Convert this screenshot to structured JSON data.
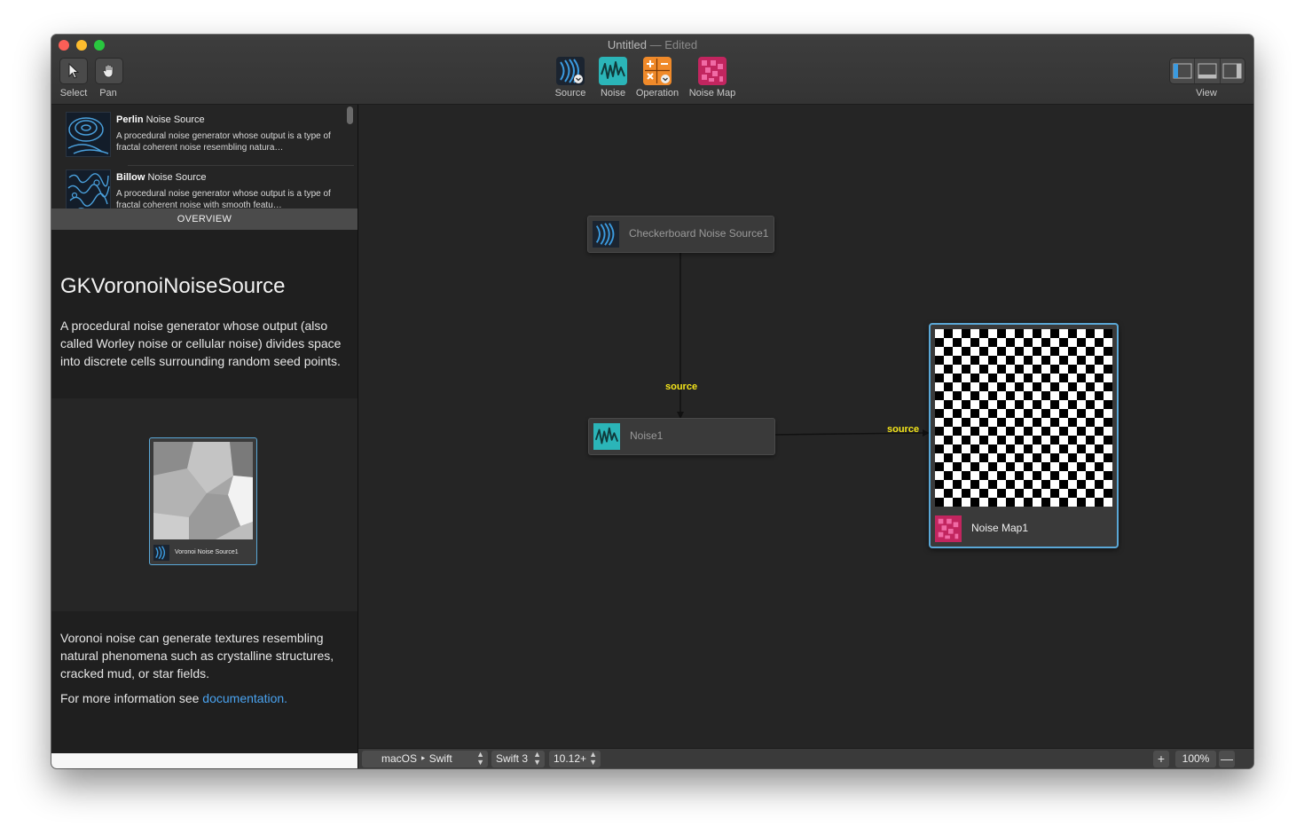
{
  "window": {
    "title": "Untitled",
    "title_suffix": "— Edited"
  },
  "toolbar": {
    "select_label": "Select",
    "pan_label": "Pan",
    "source_label": "Source",
    "noise_label": "Noise",
    "operation_label": "Operation",
    "noise_map_label": "Noise Map",
    "view_label": "View"
  },
  "library": {
    "items": [
      {
        "name": "Perlin",
        "category": "Noise Source",
        "description": "A procedural noise generator whose output is a type of fractal coherent noise resembling natura…"
      },
      {
        "name": "Billow",
        "category": "Noise Source",
        "description": "A procedural noise generator whose output is a type of fractal coherent noise with smooth featu…"
      }
    ]
  },
  "overview": {
    "header": "OVERVIEW",
    "title": "GKVoronoiNoiseSource",
    "description": "A procedural noise generator whose output (also called Worley noise or cellular noise) divides space into discrete cells surrounding random seed points.",
    "preview_label": "Voronoi Noise Source1",
    "details": "Voronoi noise can generate textures resembling natural phenomena such as crystalline structures, cracked mud, or star fields.",
    "more_prefix": "For more information see",
    "more_link": "documentation."
  },
  "canvas": {
    "nodes": {
      "checkerboard": "Checkerboard Noise Source1",
      "noise": "Noise1",
      "noise_map": "Noise Map1"
    },
    "ports": {
      "noise_input": "source",
      "map_input": "source"
    }
  },
  "bottom_bar": {
    "platform": "macOS ‣ Swift",
    "swift_version": "Swift 3",
    "os_version": "10.12+",
    "zoom": "100%"
  },
  "colors": {
    "accent_blue": "#5aa7d6",
    "port_label": "#f4e51a",
    "link": "#4aa3f0",
    "noise_map_icon": "#e0337a",
    "operation_icon": "#f08a2a",
    "noise_icon": "#2bb5b8"
  },
  "icons": [
    "arrow-cursor-icon",
    "hand-icon",
    "source-icon",
    "noise-icon",
    "operation-icon",
    "noise-map-icon",
    "left-panel-icon",
    "bottom-panel-icon",
    "right-panel-icon"
  ]
}
